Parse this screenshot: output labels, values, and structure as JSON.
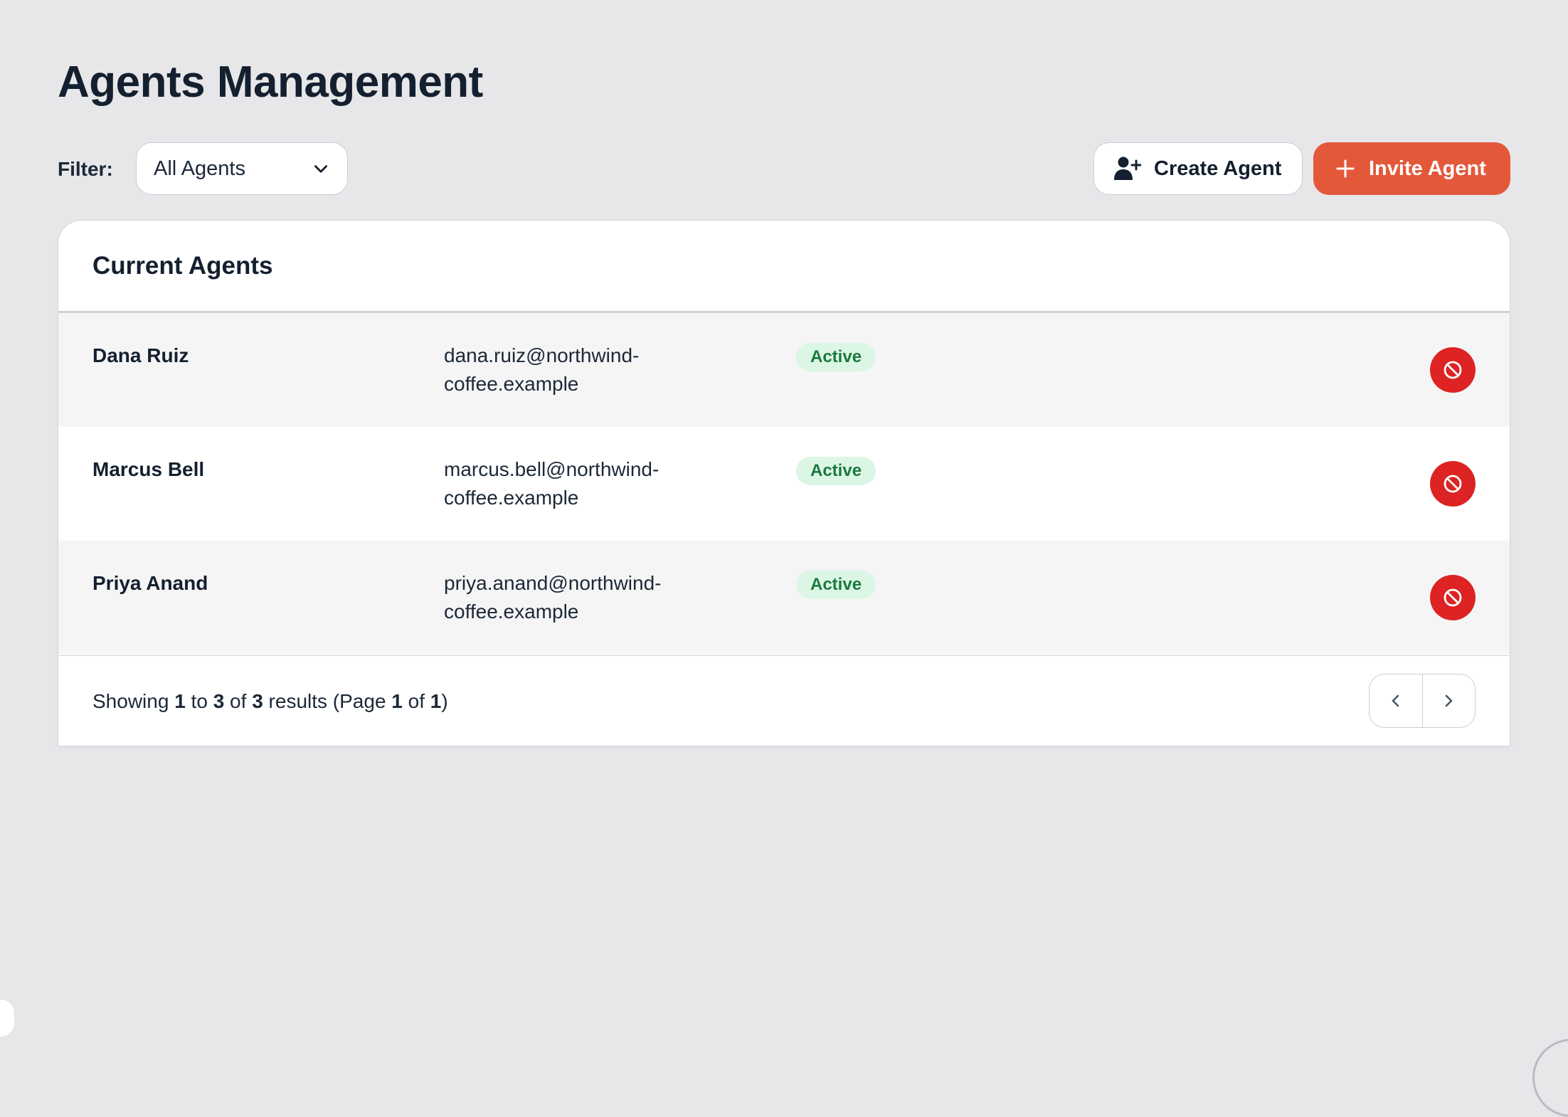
{
  "page": {
    "title": "Agents Management"
  },
  "toolbar": {
    "filter_label": "Filter:",
    "filter_value": "All Agents",
    "create_label": "Create Agent",
    "invite_label": "Invite Agent"
  },
  "card": {
    "title": "Current Agents"
  },
  "agents": [
    {
      "name": "Dana Ruiz",
      "email_line1": "dana.ruiz@northwind-",
      "email_line2": "coffee.example",
      "status": "Active"
    },
    {
      "name": "Marcus Bell",
      "email_line1": "marcus.bell@northwind-",
      "email_line2": "coffee.example",
      "status": "Active"
    },
    {
      "name": "Priya Anand",
      "email_line1": "priya.anand@northwind-",
      "email_line2": "coffee.example",
      "status": "Active"
    }
  ],
  "footer": {
    "showing_prefix": "Showing ",
    "from": "1",
    "to_word": " to ",
    "to": "3",
    "of_word": " of ",
    "total": "3",
    "results_word": " results (Page ",
    "page": "1",
    "page_of_word": " of ",
    "page_total": "1",
    "close_paren": ")"
  },
  "icons": {
    "create": "user-plus-icon",
    "invite": "plus-icon",
    "disable": "ban-icon",
    "filter_chevron": "chevron-down-icon",
    "prev": "chevron-left-icon",
    "next": "chevron-right-icon"
  },
  "colors": {
    "background": "#e7e7ea",
    "accent": "#e4583a",
    "danger": "#dd2323",
    "status_bg": "#dcf6e5",
    "status_text": "#1a7a3d"
  }
}
